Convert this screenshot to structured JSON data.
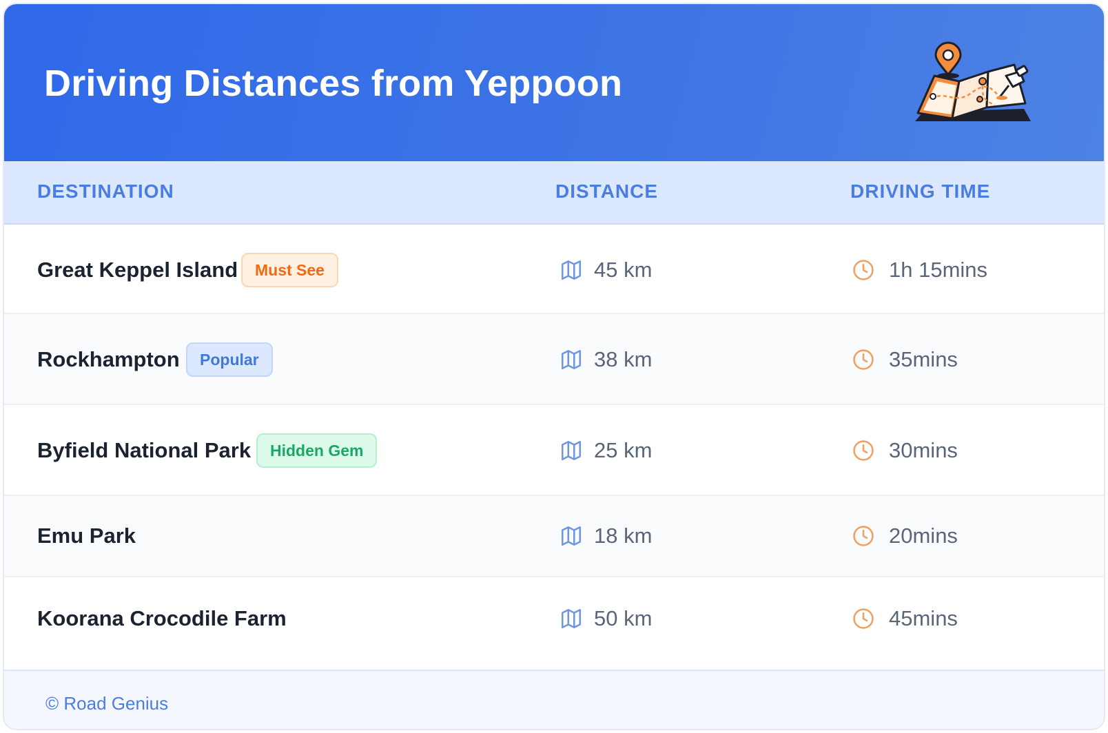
{
  "header": {
    "title": "Driving Distances from Yeppoon",
    "illustration_icon": "folded-map-with-pins-icon",
    "gradient_colors": [
      "#2f69e8",
      "#4d82e3"
    ]
  },
  "table": {
    "columns": [
      "DESTINATION",
      "DISTANCE",
      "DRIVING TIME"
    ],
    "rows": [
      {
        "destination": "Great Keppel Island",
        "badge": "Must See",
        "badge_color": "orange",
        "distance": "45 km",
        "driving_time": "1h 15mins"
      },
      {
        "destination": "Rockhampton",
        "badge": "Popular",
        "badge_color": "blue",
        "distance": "38 km",
        "driving_time": "35mins"
      },
      {
        "destination": "Byfield National Park",
        "badge": "Hidden Gem",
        "badge_color": "green",
        "distance": "25 km",
        "driving_time": "30mins"
      },
      {
        "destination": "Emu Park",
        "badge": null,
        "badge_color": null,
        "distance": "18 km",
        "driving_time": "20mins"
      },
      {
        "destination": "Koorana Crocodile Farm",
        "badge": null,
        "badge_color": null,
        "distance": "50 km",
        "driving_time": "45mins"
      }
    ],
    "distance_icon": "map-icon",
    "time_icon": "clock-icon"
  },
  "footer": {
    "credit": "© Road Genius"
  },
  "colors": {
    "accent": "#4a7de0",
    "badge_orange": "#ee6a14",
    "badge_blue": "#3f79dc",
    "badge_green": "#19a865",
    "clock_orange": "#f0a060",
    "map_blue": "#6f97e0"
  }
}
